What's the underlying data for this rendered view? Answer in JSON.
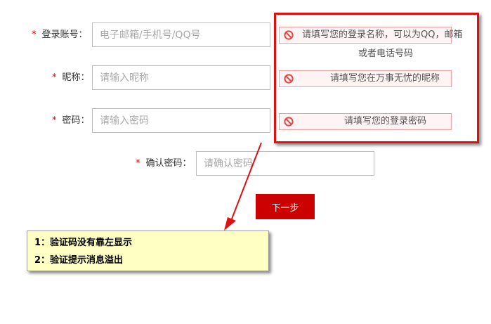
{
  "form": {
    "required_mark": "*",
    "account": {
      "label": "登录账号：",
      "placeholder": "电子邮箱/手机号/QQ号",
      "tip_line1": "请填写您的登录名称，可以为QQ，邮箱",
      "tip_line2": "或者电话号码"
    },
    "nickname": {
      "label": "昵称：",
      "placeholder": "请输入昵称",
      "tip": "请填写您在万事无忧的昵称"
    },
    "password": {
      "label": "密码：",
      "placeholder": "请输入密码",
      "tip": "请填写您的登录密码"
    },
    "confirm_password": {
      "label": "确认密码：",
      "placeholder": "请确认密码"
    },
    "next_button_label": "下一步"
  },
  "annotation": {
    "frame_color": "#e01010",
    "note_background": "#ffffc4",
    "notes": [
      "1：验证码没有靠左显示",
      "2：验证提示消息溢出"
    ]
  },
  "icons": {
    "tip_icon": "error-circle-icon"
  },
  "colors": {
    "required_star": "#e00000",
    "primary_button": "#cc0000",
    "tip_border": "#f2a0a0",
    "tip_icon": "#e64545"
  }
}
